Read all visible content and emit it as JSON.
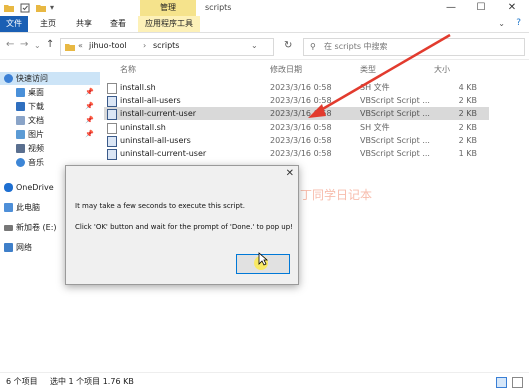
{
  "window": {
    "title": "scripts",
    "context_tab": "管理",
    "controls": [
      "—",
      "☐",
      "✕"
    ]
  },
  "ribbon": {
    "tabs": [
      {
        "label": "文件"
      },
      {
        "label": "主页"
      },
      {
        "label": "共享"
      },
      {
        "label": "查看"
      },
      {
        "label": "应用程序工具"
      }
    ]
  },
  "address": {
    "path": [
      "«",
      "jihuo-tool",
      "›",
      "scripts"
    ],
    "search_placeholder": "在 scripts 中搜索"
  },
  "nav": {
    "items": [
      {
        "label": "快速访问",
        "pinned": false,
        "selected": true
      },
      {
        "label": "桌面",
        "pinned": true
      },
      {
        "label": "下载",
        "pinned": true
      },
      {
        "label": "文档",
        "pinned": true
      },
      {
        "label": "图片",
        "pinned": true
      },
      {
        "label": "视频",
        "pinned": false
      },
      {
        "label": "音乐",
        "pinned": false
      },
      {
        "label": "OneDrive",
        "pinned": false
      },
      {
        "label": "此电脑",
        "pinned": false
      },
      {
        "label": "新加卷 (E:)",
        "pinned": false
      },
      {
        "label": "网络",
        "pinned": false
      }
    ]
  },
  "files": {
    "columns": [
      "名称",
      "修改日期",
      "类型",
      "大小"
    ],
    "rows": [
      {
        "name": "install.sh",
        "date": "2023/3/16 0:58",
        "type": "SH 文件",
        "size": "4 KB"
      },
      {
        "name": "install-all-users",
        "date": "2023/3/16 0:58",
        "type": "VBScript Script ...",
        "size": "2 KB"
      },
      {
        "name": "install-current-user",
        "date": "2023/3/16 0:58",
        "type": "VBScript Script ...",
        "size": "2 KB"
      },
      {
        "name": "uninstall.sh",
        "date": "2023/3/16 0:58",
        "type": "SH 文件",
        "size": "2 KB"
      },
      {
        "name": "uninstall-all-users",
        "date": "2023/3/16 0:58",
        "type": "VBScript Script ...",
        "size": "2 KB"
      },
      {
        "name": "uninstall-current-user",
        "date": "2023/3/16 0:58",
        "type": "VBScript Script ...",
        "size": "1 KB"
      }
    ]
  },
  "dialog": {
    "close": "✕",
    "line1": "It may take a few seconds to execute this script.",
    "line2": "Click 'OK' button and wait for the prompt of 'Done.' to pop up!"
  },
  "status": {
    "count": "6 个项目",
    "selection": "选中 1 个项目  1.76 KB"
  },
  "watermark": "丁同学日记本",
  "colors": {
    "accent": "#1a5fb4",
    "context": "#f5e38c",
    "selected": "#cce4f7"
  }
}
